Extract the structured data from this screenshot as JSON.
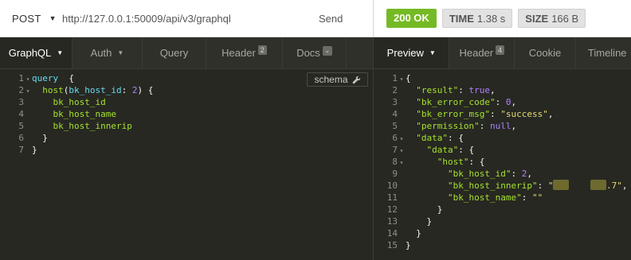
{
  "request": {
    "method": "POST",
    "url": "http://127.0.0.1:50009/api/v3/graphql",
    "send_label": "Send"
  },
  "response": {
    "status": "200 OK",
    "time_label": "TIME",
    "time_value": "1.38 s",
    "size_label": "SIZE",
    "size_value": "166 B",
    "status_color": "#75ba24"
  },
  "request_tabs": [
    {
      "label": "GraphQL",
      "active": true,
      "dropdown": true
    },
    {
      "label": "Auth",
      "dropdown": true
    },
    {
      "label": "Query"
    },
    {
      "label": "Header",
      "badge": "2"
    },
    {
      "label": "Docs",
      "icon": "chevron-down-icon"
    }
  ],
  "response_tabs": [
    {
      "label": "Preview",
      "active": true,
      "dropdown": true
    },
    {
      "label": "Header",
      "badge": "4"
    },
    {
      "label": "Cookie"
    },
    {
      "label": "Timeline"
    }
  ],
  "schema_button": {
    "label": "schema",
    "icon": "wrench-icon"
  },
  "query_lines": [
    [
      [
        "kw",
        "query"
      ],
      [
        "punc",
        "  {"
      ]
    ],
    [
      [
        "punc",
        "  "
      ],
      [
        "field",
        "host"
      ],
      [
        "punc",
        "("
      ],
      [
        "arg",
        "bk_host_id"
      ],
      [
        "punc",
        ": "
      ],
      [
        "num",
        "2"
      ],
      [
        "punc",
        ") {"
      ]
    ],
    [
      [
        "punc",
        "    "
      ],
      [
        "field",
        "bk_host_id"
      ]
    ],
    [
      [
        "punc",
        "    "
      ],
      [
        "field",
        "bk_host_name"
      ]
    ],
    [
      [
        "punc",
        "    "
      ],
      [
        "field",
        "bk_host_innerip"
      ]
    ],
    [
      [
        "punc",
        "  }"
      ]
    ],
    [
      [
        "punc",
        "}"
      ]
    ]
  ],
  "query_folds": [
    1,
    2
  ],
  "response_lines": [
    [
      [
        "punc",
        "{"
      ]
    ],
    [
      [
        "punc",
        "  "
      ],
      [
        "key",
        "\"result\""
      ],
      [
        "punc",
        ": "
      ],
      [
        "lit",
        "true"
      ],
      [
        "punc",
        ","
      ]
    ],
    [
      [
        "punc",
        "  "
      ],
      [
        "key",
        "\"bk_error_code\""
      ],
      [
        "punc",
        ": "
      ],
      [
        "lit",
        "0"
      ],
      [
        "punc",
        ","
      ]
    ],
    [
      [
        "punc",
        "  "
      ],
      [
        "key",
        "\"bk_error_msg\""
      ],
      [
        "punc",
        ": "
      ],
      [
        "str",
        "\"success\""
      ],
      [
        "punc",
        ","
      ]
    ],
    [
      [
        "punc",
        "  "
      ],
      [
        "key",
        "\"permission\""
      ],
      [
        "punc",
        ": "
      ],
      [
        "lit",
        "null"
      ],
      [
        "punc",
        ","
      ]
    ],
    [
      [
        "punc",
        "  "
      ],
      [
        "key",
        "\"data\""
      ],
      [
        "punc",
        ": {"
      ]
    ],
    [
      [
        "punc",
        "    "
      ],
      [
        "key",
        "\"data\""
      ],
      [
        "punc",
        ": {"
      ]
    ],
    [
      [
        "punc",
        "      "
      ],
      [
        "key",
        "\"host\""
      ],
      [
        "punc",
        ": {"
      ]
    ],
    [
      [
        "punc",
        "        "
      ],
      [
        "key",
        "\"bk_host_id\""
      ],
      [
        "punc",
        ": "
      ],
      [
        "lit",
        "2"
      ],
      [
        "punc",
        ","
      ]
    ],
    [
      [
        "punc",
        "        "
      ],
      [
        "key",
        "\"bk_host_innerip\""
      ],
      [
        "punc",
        ": "
      ],
      [
        "str",
        "\""
      ],
      [
        "redact",
        ""
      ],
      [
        "str",
        "    "
      ],
      [
        "redact",
        ""
      ],
      [
        "str",
        ".7\""
      ],
      [
        "punc",
        ","
      ]
    ],
    [
      [
        "punc",
        "        "
      ],
      [
        "key",
        "\"bk_host_name\""
      ],
      [
        "punc",
        ": "
      ],
      [
        "str",
        "\"\""
      ]
    ],
    [
      [
        "punc",
        "      }"
      ]
    ],
    [
      [
        "punc",
        "    }"
      ]
    ],
    [
      [
        "punc",
        "  }"
      ]
    ],
    [
      [
        "punc",
        "}"
      ]
    ]
  ],
  "response_folds": [
    1,
    6,
    7,
    8
  ]
}
